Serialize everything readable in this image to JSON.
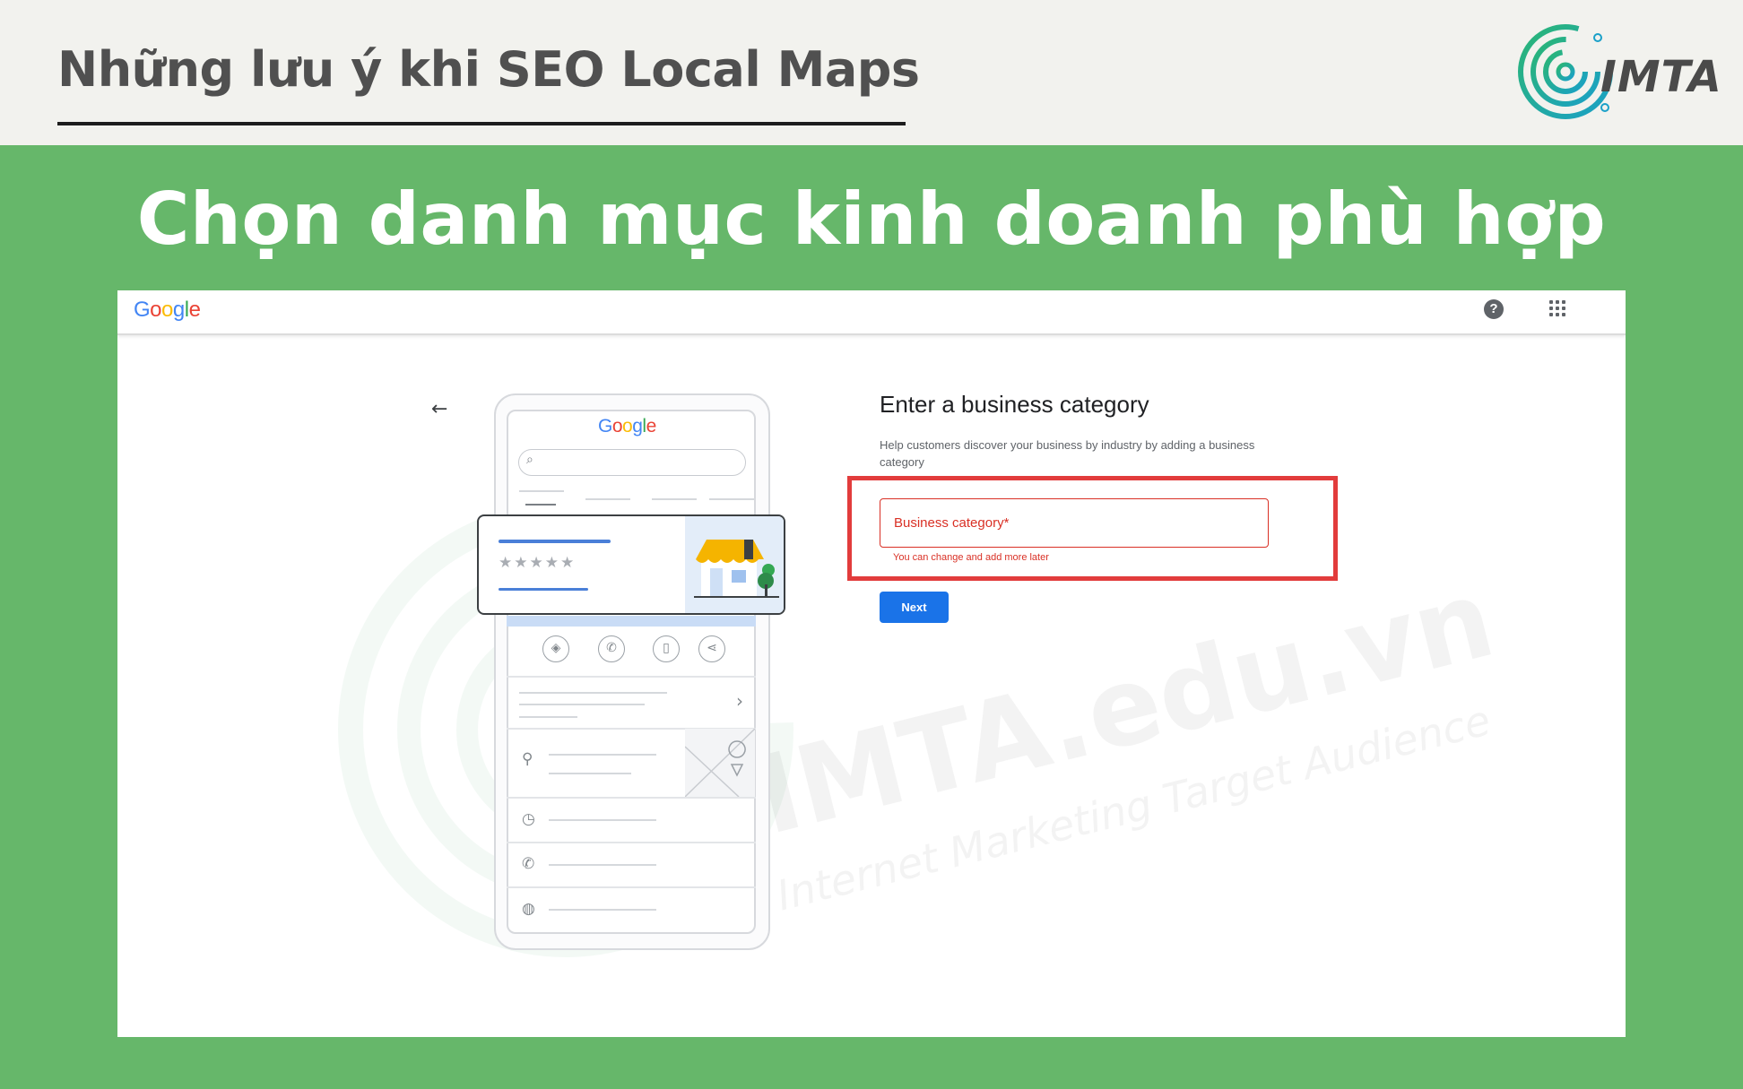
{
  "slide": {
    "top_title": "Những lưu ý khi SEO Local Maps",
    "heading": "Chọn danh mục kinh doanh phù hợp",
    "logo_text": "IMTA",
    "watermark": "IMTA.edu.vn",
    "watermark_sub": "Internet Marketing Target Audience"
  },
  "google_bar": {
    "logo_letters": [
      {
        "ch": "G",
        "color": "#4285F4"
      },
      {
        "ch": "o",
        "color": "#EA4335"
      },
      {
        "ch": "o",
        "color": "#FBBC05"
      },
      {
        "ch": "g",
        "color": "#4285F4"
      },
      {
        "ch": "l",
        "color": "#34A853"
      },
      {
        "ch": "e",
        "color": "#EA4335"
      }
    ],
    "help_symbol": "?",
    "help_icon": "help-icon",
    "apps_icon": "apps-grid-icon"
  },
  "form": {
    "back_symbol": "←",
    "title": "Enter a business category",
    "help_text": "Help customers discover your business by industry by adding a business category",
    "input_placeholder": "Business category*",
    "input_value": "",
    "hint": "You can change and add more later",
    "next_label": "Next"
  },
  "illustration": {
    "stars": "★★★★★",
    "search_symbol": "⌕",
    "chevron_symbol": "›",
    "action_symbols": [
      "◈",
      "✆",
      "▯",
      "⋖"
    ],
    "row_symbols": [
      "⚲",
      "◷",
      "✆",
      "◍"
    ]
  },
  "colors": {
    "slide_green": "#66b76a",
    "highlight_red": "#e23c3c",
    "error_red": "#d93025",
    "button_blue": "#1a73e8"
  }
}
